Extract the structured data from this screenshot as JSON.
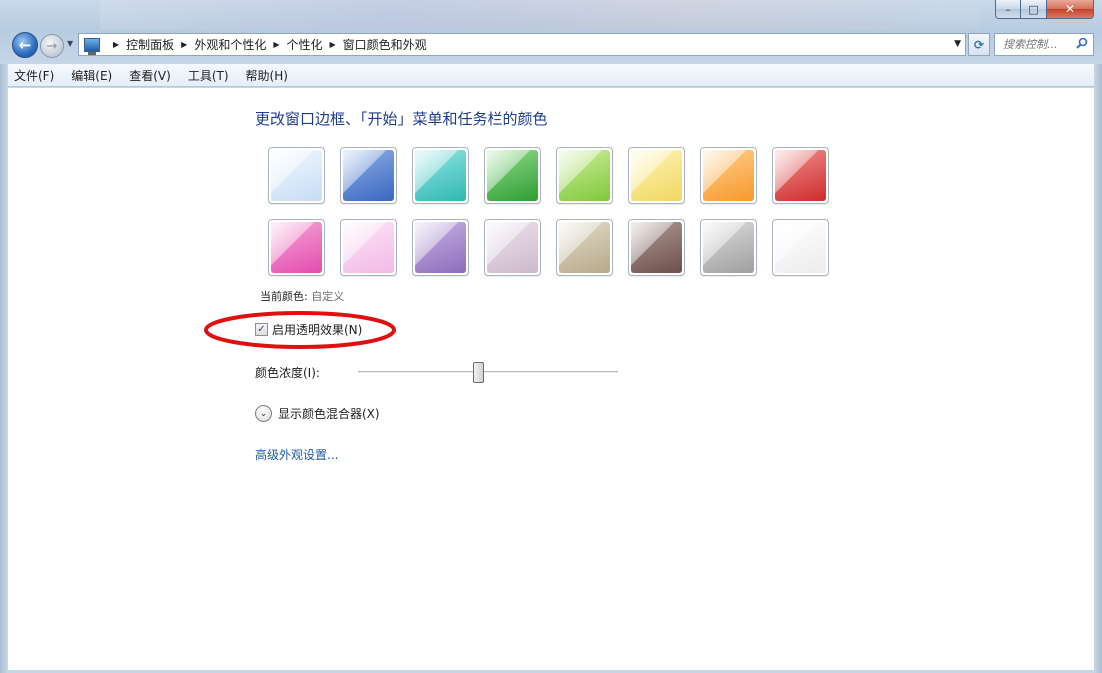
{
  "window": {
    "caption": {
      "minimize": "–",
      "maximize": "□",
      "close": "✕"
    }
  },
  "navbar": {
    "back_glyph": "←",
    "forward_glyph": "→",
    "recent_glyph": "▼",
    "breadcrumbs": [
      "控制面板",
      "外观和个性化",
      "个性化",
      "窗口颜色和外观"
    ],
    "separator_glyph": "▶",
    "dropdown_glyph": "▼",
    "refresh_glyph": "⟳",
    "search_placeholder": "搜索控制..."
  },
  "menubar": {
    "items": [
      "文件(F)",
      "编辑(E)",
      "查看(V)",
      "工具(T)",
      "帮助(H)"
    ]
  },
  "content": {
    "title": "更改窗口边框、「开始」菜单和任务栏的颜色",
    "swatches": [
      {
        "colors": [
          "#f3f8fe",
          "#c6dcf5"
        ]
      },
      {
        "colors": [
          "#8eaee6",
          "#3a68c0"
        ]
      },
      {
        "colors": [
          "#93e5e2",
          "#2fb8b4"
        ]
      },
      {
        "colors": [
          "#8fdc8a",
          "#2f9d33"
        ]
      },
      {
        "colors": [
          "#cdee9c",
          "#80c83a"
        ]
      },
      {
        "colors": [
          "#fff4b3",
          "#f1d763"
        ]
      },
      {
        "colors": [
          "#ffd08d",
          "#f7982c"
        ]
      },
      {
        "colors": [
          "#ef8f8f",
          "#cf2c2c"
        ]
      },
      {
        "colors": [
          "#f7a6d8",
          "#e24caf"
        ]
      },
      {
        "colors": [
          "#fde5f7",
          "#f2b9e6"
        ]
      },
      {
        "colors": [
          "#c8b4e2",
          "#8c6cbc"
        ]
      },
      {
        "colors": [
          "#ece1ec",
          "#cdb9cd"
        ]
      },
      {
        "colors": [
          "#e3dccb",
          "#b6a98a"
        ]
      },
      {
        "colors": [
          "#b19a96",
          "#6c4f4a"
        ]
      },
      {
        "colors": [
          "#dcdcdc",
          "#9f9f9f"
        ]
      },
      {
        "colors": [
          "#ffffff",
          "#ececec"
        ]
      }
    ],
    "current_color_label": "当前颜色:",
    "current_color_value": "自定义",
    "transparency": {
      "label": "启用透明效果(N)",
      "checked": true,
      "check_glyph": "✓"
    },
    "intensity": {
      "label": "颜色浓度(I):",
      "value_fraction": 0.46
    },
    "mixer": {
      "label": "显示颜色混合器(X)",
      "chevron_glyph": "⌄"
    },
    "advanced_link": "高级外观设置..."
  },
  "annotation": {
    "color": "#e01010"
  }
}
